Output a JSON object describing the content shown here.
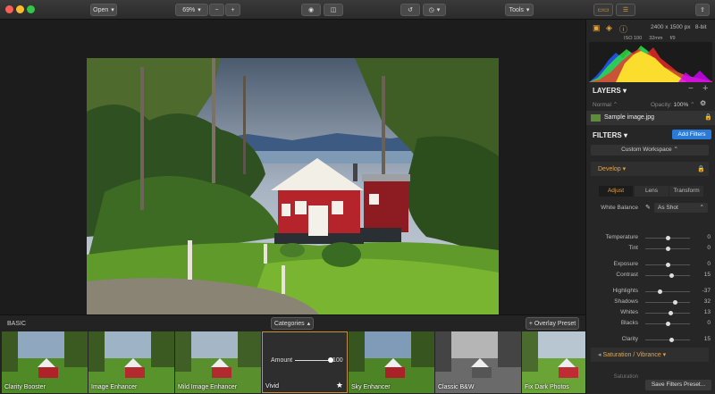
{
  "toolbar": {
    "open_label": "Open",
    "zoom_value": "69%",
    "zoom_minus": "−",
    "zoom_plus": "+",
    "tools_label": "Tools"
  },
  "info": {
    "dimensions": "2400 x 1500 px",
    "bit_depth": "8-bit",
    "iso": "ISO 100",
    "focal": "32mm",
    "aperture": "f/9"
  },
  "layers": {
    "title": "LAYERS",
    "blend_mode": "Normal",
    "opacity_label": "Opacity:",
    "opacity_value": "100%",
    "layer_name": "Sample image.jpg"
  },
  "filters": {
    "title": "FILTERS",
    "add_button": "Add Filters",
    "workspace": "Custom Workspace",
    "develop_label": "Develop",
    "tabs": [
      "Adjust",
      "Lens",
      "Transform"
    ],
    "white_balance_label": "White Balance",
    "white_balance_value": "As Shot",
    "sliders": [
      {
        "name": "Temperature",
        "value": "0",
        "pos": 0.5
      },
      {
        "name": "Tint",
        "value": "0",
        "pos": 0.5
      },
      {
        "name": "Exposure",
        "value": "0",
        "pos": 0.5
      },
      {
        "name": "Contrast",
        "value": "15",
        "pos": 0.57
      },
      {
        "name": "Highlights",
        "value": "-37",
        "pos": 0.32
      },
      {
        "name": "Shadows",
        "value": "32",
        "pos": 0.66
      },
      {
        "name": "Whites",
        "value": "13",
        "pos": 0.56
      },
      {
        "name": "Blacks",
        "value": "0",
        "pos": 0.5
      },
      {
        "name": "Clarity",
        "value": "15",
        "pos": 0.57
      }
    ],
    "saturation_label": "Saturation / Vibrance",
    "saturation_sub": "Saturation",
    "save_button": "Save Filters Preset..."
  },
  "strip": {
    "section": "BASIC",
    "categories": "Categories",
    "overlay": "+ Overlay Preset",
    "amount_label": "Amount",
    "amount_value": "100",
    "amount_pos": 1.0,
    "presets": [
      "Clarity Booster",
      "Image Enhancer",
      "Mild Image Enhancer",
      "Vivid",
      "Sky Enhancer",
      "Classic B&W",
      "Fix Dark Photos"
    ]
  },
  "colors": {
    "accent": "#e8a33a",
    "blue": "#2a7ad8",
    "selected_border": "#c8913a"
  }
}
